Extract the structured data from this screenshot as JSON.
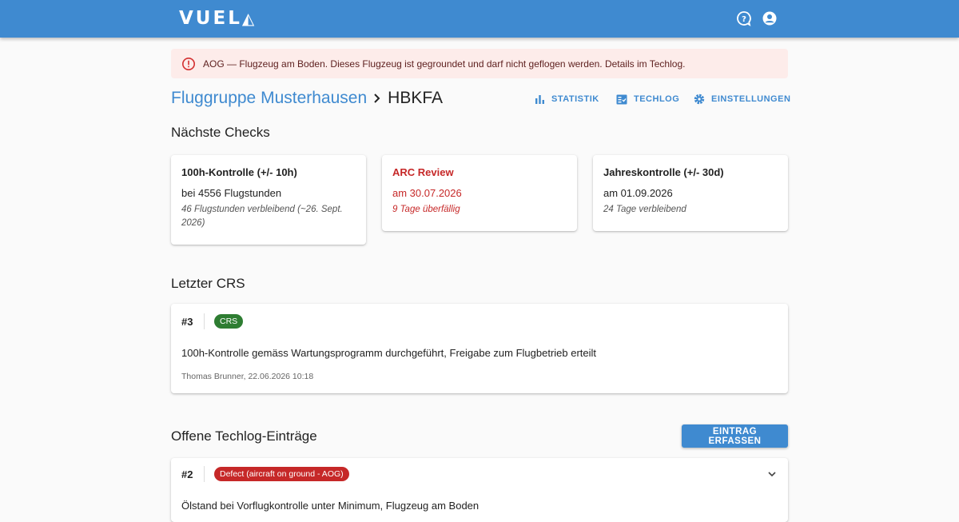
{
  "app": {
    "logo": "VUEL",
    "logo_mark": "◭"
  },
  "header": {
    "icons": [
      "help-icon",
      "account-icon"
    ]
  },
  "alert": {
    "text": "AOG — Flugzeug am Boden. Dieses Flugzeug ist gegroundet und darf nicht geflogen werden. Details im Techlog."
  },
  "breadcrumb": {
    "group": "Fluggruppe Musterhausen",
    "aircraft": "HBKFA"
  },
  "nav": {
    "statistik": "STATISTIK",
    "techlog": "TECHLOG",
    "einstellungen": "EINSTELLUNGEN"
  },
  "checks": {
    "title": "Nächste Checks",
    "items": [
      {
        "title": "100h-Kontrolle (+/- 10h)",
        "main": "bei 4556 Flugstunden",
        "sub": "46 Flugstunden verbleibend (~26. Sept. 2026)",
        "status": "ok"
      },
      {
        "title": "ARC Review",
        "main": "am 30.07.2026",
        "sub": "9 Tage überfällig",
        "status": "overdue"
      },
      {
        "title": "Jahreskontrolle (+/- 30d)",
        "main": "am 01.09.2026",
        "sub": "24 Tage verbleibend",
        "status": "ok"
      }
    ]
  },
  "crs": {
    "title": "Letzter CRS",
    "number": "#3",
    "chip": "CRS",
    "description": "100h-Kontrolle gemäss Wartungsprogramm durchgeführt, Freigabe zum Flugbetrieb erteilt",
    "meta": "Thomas Brunner, 22.06.2026 10:18"
  },
  "techlog": {
    "title": "Offene Techlog-Einträge",
    "add_button": "EINTRAG ERFASSEN",
    "entries": [
      {
        "number": "#2",
        "chip": "Defect (aircraft on ground - AOG)",
        "text": "Ölstand bei Vorflugkontrolle unter Minimum, Flugzeug am Boden"
      }
    ]
  },
  "colors": {
    "primary": "#3f8ad0",
    "error": "#c62828",
    "success": "#2e7d32",
    "alert_bg": "#fdecea"
  }
}
